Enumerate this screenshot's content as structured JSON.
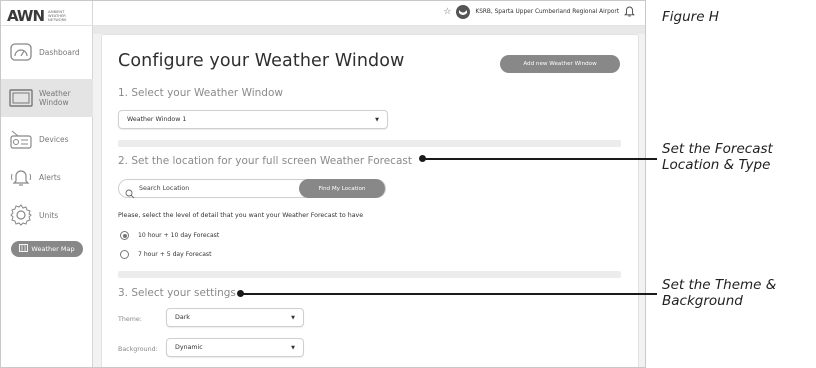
{
  "figure_label": "Figure H",
  "logo": {
    "main": "AWN",
    "sub": "Ambient Weather Network"
  },
  "sidebar": {
    "items": [
      {
        "label": "Dashboard",
        "icon": "gauge-icon",
        "active": false
      },
      {
        "label": "Weather Window",
        "icon": "monitor-icon",
        "active": true
      },
      {
        "label": "Devices",
        "icon": "weather-station-icon",
        "active": false
      },
      {
        "label": "Alerts",
        "icon": "bell-alert-icon",
        "active": false
      },
      {
        "label": "Units",
        "icon": "gear-icon",
        "active": false
      }
    ],
    "map_button": "Weather Map"
  },
  "topbar": {
    "station": "KSRB, Sparta Upper Cumberland Regional Airport"
  },
  "main": {
    "title": "Configure your Weather Window",
    "add_button": "Add new Weather Window",
    "section1": {
      "title": "1. Select your Weather Window",
      "selected": "Weather Window 1"
    },
    "section2": {
      "title": "2. Set the location for your full screen Weather Forecast",
      "search_placeholder": "Search Location",
      "find_button": "Find My Location",
      "detail_prompt": "Please, select the level of detail that you want your Weather Forecast to have",
      "options": [
        {
          "label": "10 hour + 10 day Forecast",
          "selected": true
        },
        {
          "label": "7 hour + 5 day Forecast",
          "selected": false
        }
      ]
    },
    "section3": {
      "title": "3. Select your settings",
      "theme_label": "Theme:",
      "theme_value": "Dark",
      "background_label": "Background:",
      "background_value": "Dynamic"
    }
  },
  "annotations": {
    "forecast_line1": "Set the Forecast",
    "forecast_line2": "Location & Type",
    "theme_line1": "Set the Theme &",
    "theme_line2": "Background"
  }
}
